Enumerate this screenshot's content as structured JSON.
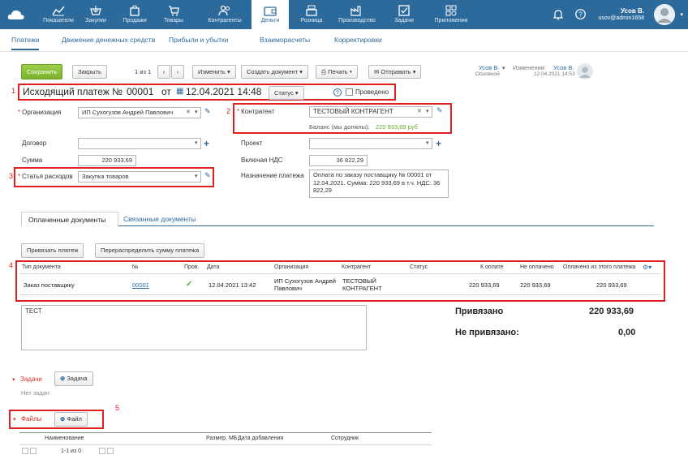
{
  "topnav": {
    "items": [
      {
        "label": "Показатели",
        "icon": "chart-line-icon"
      },
      {
        "label": "Закупки",
        "icon": "cart-down-icon"
      },
      {
        "label": "Продажи",
        "icon": "bag-icon"
      },
      {
        "label": "Товары",
        "icon": "box-icon"
      },
      {
        "label": "Контрагенты",
        "icon": "users-icon"
      },
      {
        "label": "Деньги",
        "icon": "wallet-icon"
      },
      {
        "label": "Розница",
        "icon": "cash-register-icon"
      },
      {
        "label": "Производство",
        "icon": "factory-icon"
      },
      {
        "label": "Задачи",
        "icon": "checkbox-icon"
      },
      {
        "label": "Приложения",
        "icon": "apps-grid-icon"
      }
    ],
    "active": "Деньги"
  },
  "user": {
    "name": "Усов В.",
    "email": "usov@admin1658"
  },
  "subtabs": [
    "Платежи",
    "Движение денежных средств",
    "Прибыли и убытки",
    "Взаиморасчеты",
    "Корректировки"
  ],
  "toolbar": {
    "save": "Сохранить",
    "close": "Закрыть",
    "pager": "1 из 1",
    "prev": "‹",
    "next": "›",
    "change": "Изменить",
    "create_doc": "Создать документ",
    "print": "Печать",
    "send": "Отправить"
  },
  "owner": {
    "name": "Усов В.",
    "dept": "Основной",
    "changes_label": "Изменения:",
    "changes_user": "Усов В.",
    "changes_date": "12.04.2021 14:53"
  },
  "doc": {
    "title": "Исходящий платеж №",
    "number": "00001",
    "from": "от",
    "date": "12.04.2021 14:48",
    "status": "Статус",
    "conducted": "Проведено"
  },
  "form": {
    "org_label": "Организация",
    "org_value": "ИП Сухогузов Андрей Павлович",
    "contract_label": "Договор",
    "sum_label": "Сумма",
    "sum_value": "220 933,69",
    "expense_label": "Статья расходов",
    "expense_value": "Закупка товаров",
    "counterparty_label": "Контрагент",
    "counterparty_value": "ТЕСТОВЫЙ КОНТРАГЕНТ",
    "balance_label": "Баланс (мы должны):",
    "balance_value": "220 933,69 руб",
    "project_label": "Проект",
    "vat_label": "Включая НДС",
    "vat_value": "36 822,29",
    "purpose_label": "Назначение платежа",
    "purpose_value": "Оплата по заказу поставщику № 00001 от 12.04.2021. Сумма: 220 933,69  в т.ч. НДС: 36 822,29"
  },
  "doc_tabs": [
    "Оплаченные документы",
    "Связанные документы"
  ],
  "actions": {
    "bind": "Привязать платеж",
    "redistribute": "Перераспределить сумму платежа"
  },
  "table": {
    "headers": [
      "Тип документа",
      "№",
      "Пров.",
      "Дата",
      "Организация",
      "Контрагент",
      "Статус",
      "К оплате",
      "Не оплачено",
      "Оплачено из этого платежа"
    ],
    "rows": [
      [
        "Заказ поставщику",
        "00001",
        "✓",
        "12.04.2021 13:42",
        "ИП Сухогузов Андрей Павлович",
        "ТЕСТОВЫЙ КОНТРАГЕНТ",
        "",
        "220 933,69",
        "220 933,69",
        "220 933,69"
      ]
    ]
  },
  "comment": "ТЕСТ",
  "summary": {
    "bound_label": "Привязано",
    "bound_value": "220 933,69",
    "unbound_label": "Не привязано:",
    "unbound_value": "0,00"
  },
  "tasks": {
    "label": "Задачи",
    "add": "Задача",
    "empty": "Нет задач"
  },
  "files": {
    "label": "Файлы",
    "add": "Файл",
    "headers": [
      "Наименование",
      "Размер, МБ",
      "Дата добавления",
      "Сотрудник"
    ],
    "pager": "1-1 из 0"
  },
  "markers": [
    "1",
    "2",
    "3",
    "4",
    "5"
  ],
  "colors": {
    "topbar": "#2d6a9c",
    "accent": "#2d6a9c",
    "save": "#8cc43c",
    "highlight": "#e02020"
  }
}
